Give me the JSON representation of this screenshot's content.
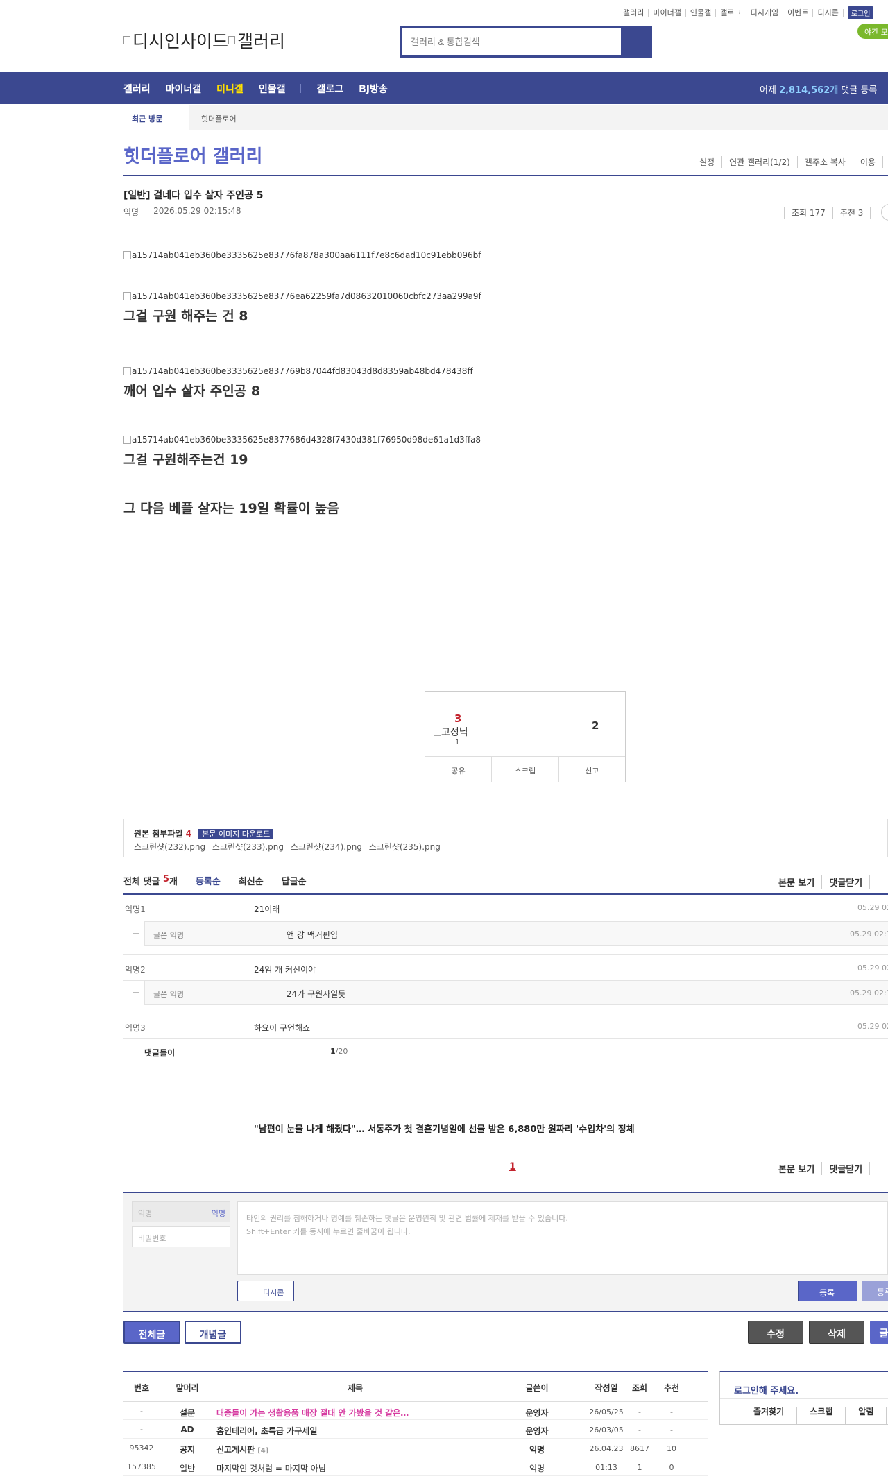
{
  "header": {
    "top_links": [
      "갤러리",
      "마이너갤",
      "인물갤",
      "갤로그",
      "디시게임",
      "이벤트",
      "디시콘"
    ],
    "login": "로그인",
    "night": "야간 모",
    "logo_alt_1": "디시인사이드",
    "logo_alt_2": "갤러리",
    "search_placeholder": "갤러리 & 통합검색"
  },
  "gnb": {
    "menu": [
      "갤러리",
      "마이너갤",
      "미니갤",
      "인물갤",
      "갤로그",
      "BJ방송"
    ],
    "active": "미니갤",
    "stat_prefix": "어제 ",
    "stat_count": "2,814,562개",
    "stat_suffix": " 댓글 등록"
  },
  "visit": {
    "label": "최근 방문",
    "item": "힛더플로어"
  },
  "gallery": {
    "title": "힛더플로어 갤러리",
    "options": [
      "설정",
      "연관 갤러리(1/2)",
      "갤주소 복사",
      "이용"
    ]
  },
  "post": {
    "title": "[일반] 걸네다 입수 살자 주인공 5",
    "writer": "익명",
    "date": "2026.05.29 02:15:48",
    "views": "조회 177",
    "recommend": "추천 3",
    "images": [
      "a15714ab041eb360be3335625e83776fa878a300aa6111f7e8c6dad10c91ebb096bf",
      "a15714ab041eb360be3335625e83776ea62259fa7d08632010060cbfc273aa299a9f",
      "a15714ab041eb360be3335625e837769b87044fd83043d8d8359ab48bd478438ff",
      "a15714ab041eb360be3335625e8377686d4328f7430d381f76950d98de61a1d3ffa8"
    ],
    "lines": [
      "그걸 구원 해주는 건 8",
      "깨어 입수 살자 주인공 8",
      "그걸 구원해주는건 19",
      "그 다음 베플 살자는 19일 확률이 높음"
    ]
  },
  "recommend_box": {
    "up": "3",
    "fix_alt": "고정닉",
    "fix_count": "1",
    "down": "2",
    "actions": [
      "공유",
      "스크랩",
      "신고"
    ]
  },
  "attach": {
    "label": "원본 첨부파일",
    "count": "4",
    "download": "본문 이미지 다운로드",
    "files": [
      "스크린샷(232).png",
      "스크린샷(233).png",
      "스크린샷(234).png",
      "스크린샷(235).png"
    ]
  },
  "comments": {
    "label": "전체 댓글",
    "count": "5",
    "unit": "개",
    "sorts": [
      "등록순",
      "최신순",
      "답글순"
    ],
    "right_links": [
      "본문 보기",
      "댓글닫기"
    ],
    "rows": [
      {
        "nick": "익명1",
        "text": "21이래",
        "date": "05.29 02"
      },
      {
        "nick": "글쓴 익명",
        "text": "앤 걍 맥거핀임",
        "date": "05.29 02:1"
      },
      {
        "nick": "익명2",
        "text": "24임 개 커신이야",
        "date": "05.29 02"
      },
      {
        "nick": "글쓴 익명",
        "text": "24가 구원자일듯",
        "date": "05.29 02:1"
      },
      {
        "nick": "익명3",
        "text": "하요이 구언해죠",
        "date": "05.29 02"
      }
    ],
    "dol_label": "댓글돌이",
    "dol_page": "1",
    "dol_total": "/20"
  },
  "news": "\"남편이 눈물 나게 해줬다\"… 서동주가 첫 결혼기념일에 선물 받은 6,880만 원짜리 '수입차'의 정체",
  "pager": "1",
  "write": {
    "nick_placeholder": "익명",
    "nick_tag": "익명",
    "pw_placeholder": "비밀번호",
    "notice_1": "타인의 권리를 침해하거나 명예를 훼손하는 댓글은 운영원칙 및 관련 법률에 제재를 받을 수 있습니다.",
    "notice_2": "Shift+Enter 키를 동시에 누르면 줄바꿈이 됩니다.",
    "dccon": "디시콘",
    "submit": "등록",
    "submit2": "등록"
  },
  "buttons": {
    "all": "전체글",
    "concept": "개념글",
    "edit": "수정",
    "delete": "삭제",
    "more": "글"
  },
  "list": {
    "headers": [
      "번호",
      "말머리",
      "제목",
      "글쓴이",
      "작성일",
      "조회",
      "추천"
    ],
    "rows": [
      {
        "no": "-",
        "head": "설문",
        "title": "대중들이 가는 생활용품 매장 절대 안 가봤을 것 같은…",
        "writer": "운영자",
        "date": "26/05/25",
        "views": "-",
        "rec": "-"
      },
      {
        "no": "-",
        "head": "AD",
        "title": "홈인테리어, 초특급 가구세일",
        "writer": "운영자",
        "date": "26/03/05",
        "views": "-",
        "rec": "-"
      },
      {
        "no": "95342",
        "head": "공지",
        "title": "신고게시판",
        "reply": "[4]",
        "writer": "익명",
        "date": "26.04.23",
        "views": "8617",
        "rec": "10"
      },
      {
        "no": "157385",
        "head": "일반",
        "title": "마지막인 것처럼 = 마지막 아님",
        "writer": "익명",
        "date": "01:13",
        "views": "1",
        "rec": "0"
      }
    ]
  },
  "login_panel": {
    "title": "로그인해 주세요.",
    "links": [
      "즐겨찾기",
      "스크랩",
      "알림"
    ]
  },
  "colors": {
    "brand": "#3b4890",
    "accent": "#5a66c8",
    "red": "#c3232d",
    "night": "#7ab82c"
  }
}
